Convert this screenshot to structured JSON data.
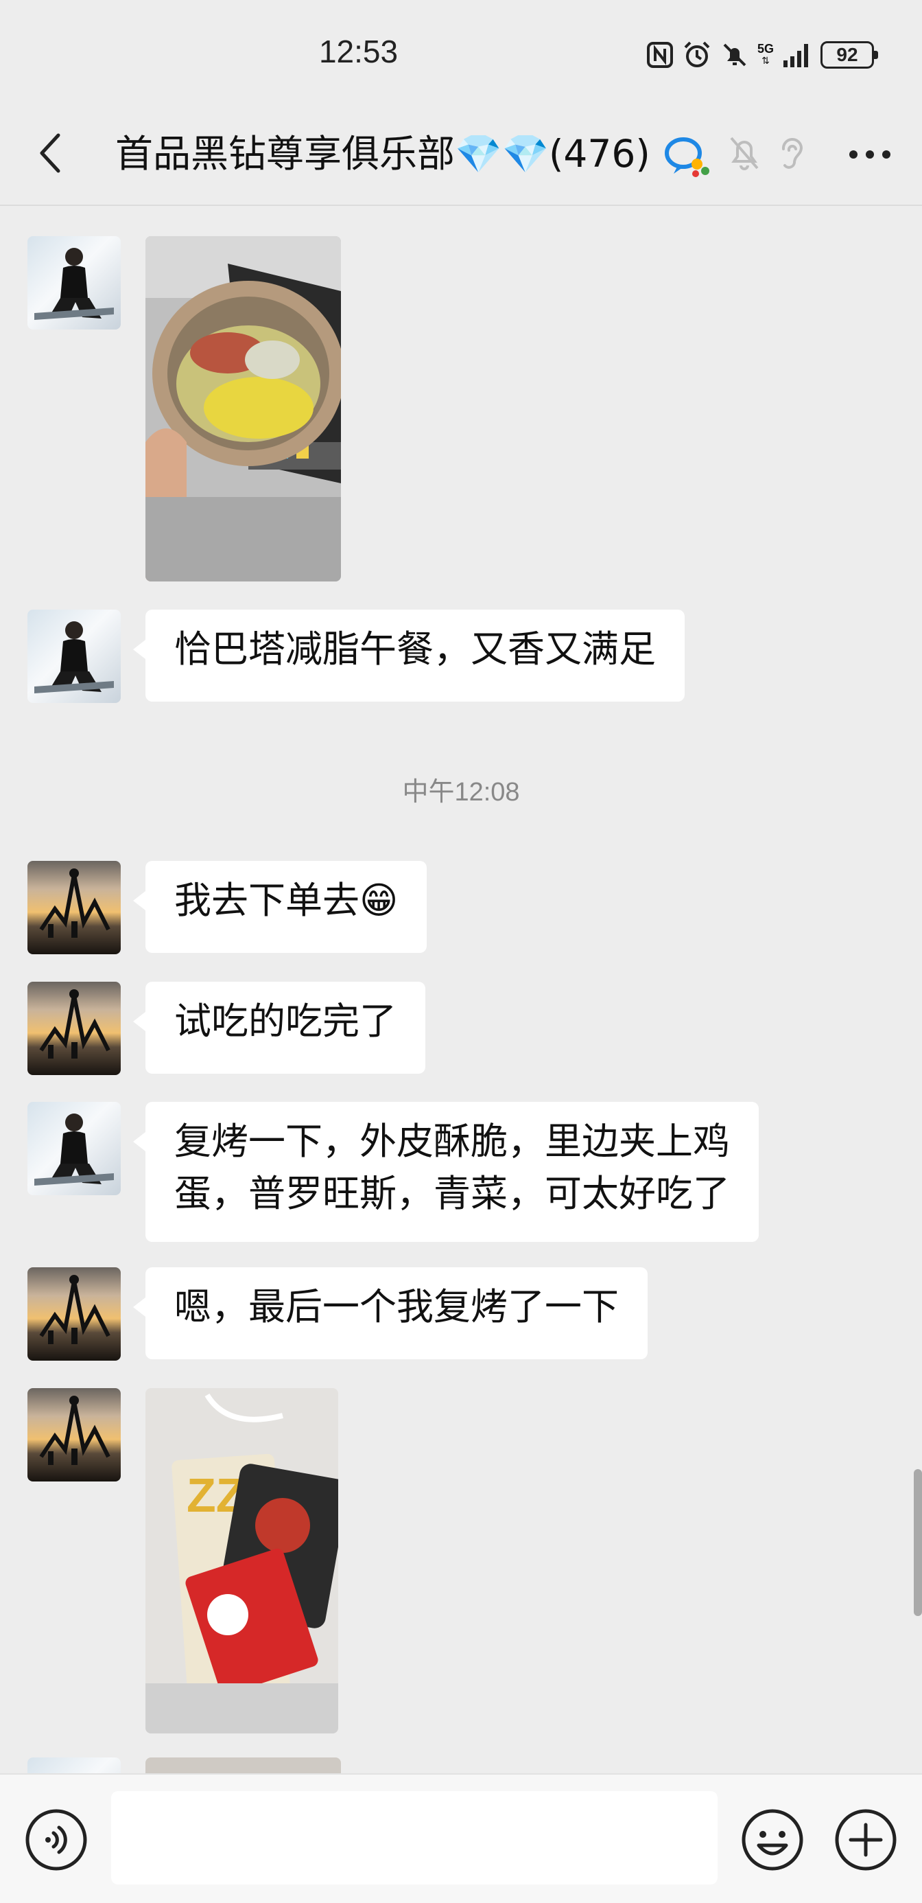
{
  "status_bar": {
    "time": "12:53",
    "battery": "92",
    "network": "5G"
  },
  "header": {
    "title": "首品黑钻尊享俱乐部💎💎(476)"
  },
  "messages": {
    "text1": "恰巴塔减脂午餐，又香又满足",
    "timestamp": "中午12:08",
    "text2": "我去下单去😁",
    "text3": "试吃的吃完了",
    "text4_line1": "复烤一下，外皮酥脆，里边夹上鸡",
    "text4_line2": "蛋，普罗旺斯，青菜，可太好吃了",
    "text5": "嗯，最后一个我复烤了一下"
  },
  "input": {
    "value": "",
    "placeholder": ""
  },
  "icons": {
    "back": "chevron-left-icon",
    "chat_bubble": "chat-bubble-icon",
    "mute": "bell-off-icon",
    "earpiece": "ear-icon",
    "more": "more-dots-icon",
    "voice": "voice-icon",
    "emoji": "emoji-icon",
    "plus": "plus-icon"
  },
  "colors": {
    "background": "#ededed",
    "bubble": "#ffffff",
    "accent_blue": "#1e88e5"
  }
}
